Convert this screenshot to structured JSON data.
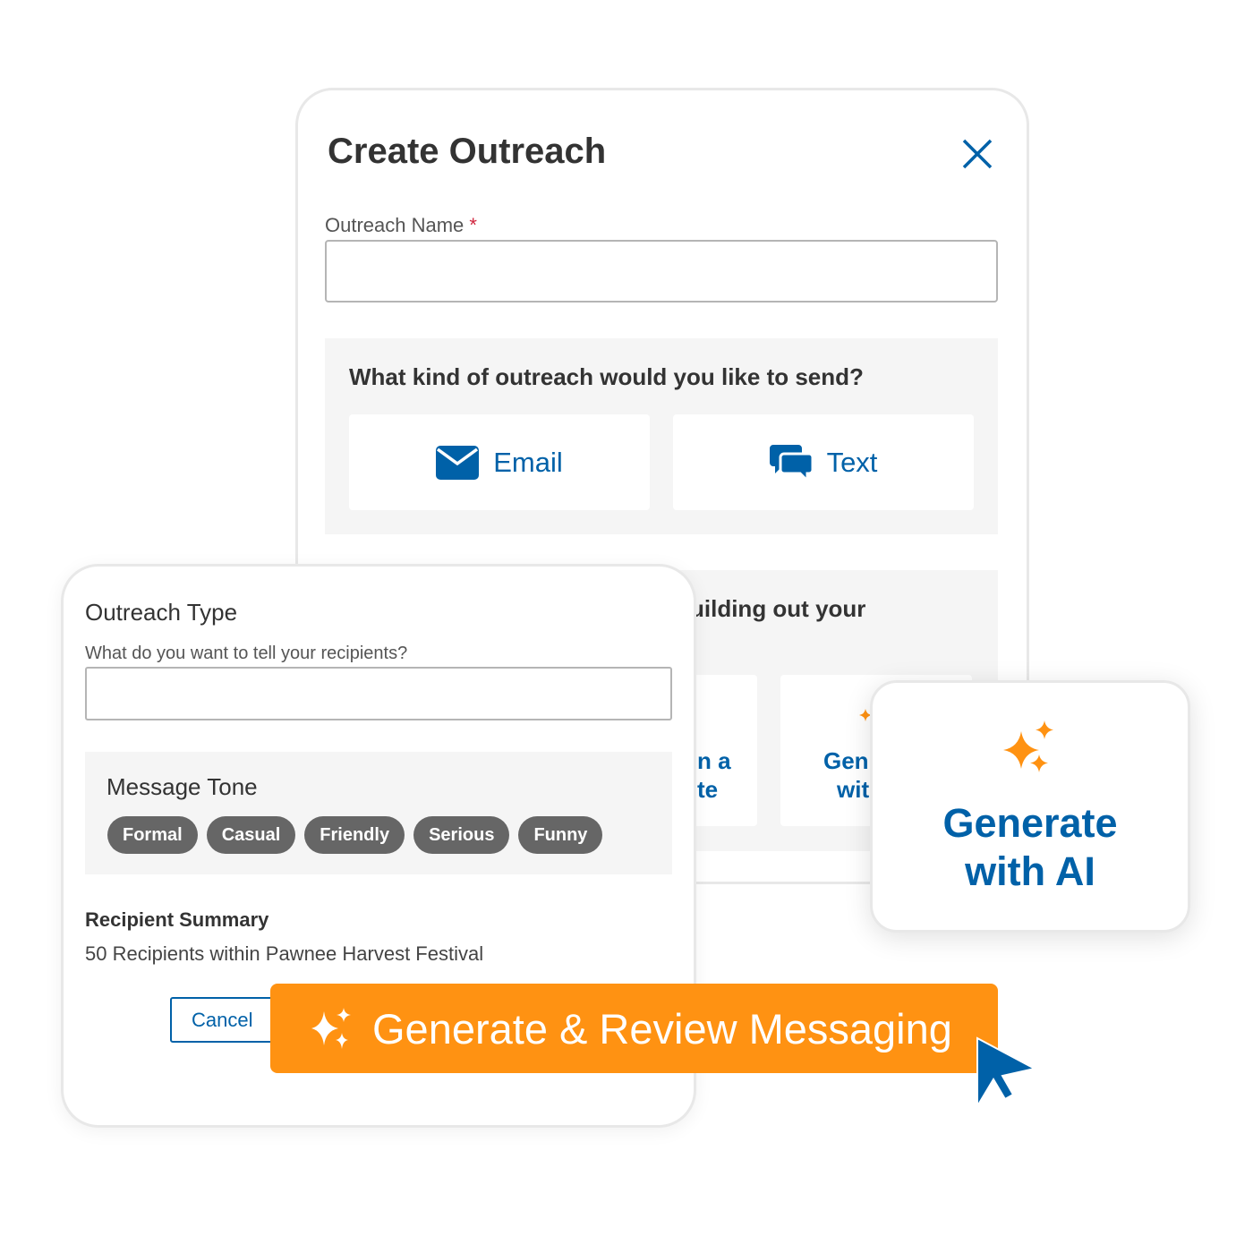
{
  "dialog": {
    "title": "Create Outreach",
    "close_icon": "close-icon",
    "name_label": "Outreach Name",
    "required_mark": "*",
    "name_value": "",
    "kind_question": "What kind of outreach would you like to send?",
    "options": [
      {
        "label": "Email",
        "icon": "envelope-icon"
      },
      {
        "label": "Text",
        "icon": "chat-bubbles-icon"
      }
    ],
    "build_text_fragment": "uilding out your",
    "start_options": [
      {
        "line1": "n a",
        "line2": "te"
      },
      {
        "line1": "Gen",
        "line2": "wit"
      }
    ]
  },
  "outreach_type": {
    "title": "Outreach Type",
    "question": "What do you want to tell your recipients?",
    "value": "",
    "tone_title": "Message Tone",
    "tones": [
      "Formal",
      "Casual",
      "Friendly",
      "Serious",
      "Funny"
    ],
    "recipient_title": "Recipient Summary",
    "recipient_text": "50 Recipients within Pawnee Harvest Festival",
    "cancel_label": "Cancel",
    "generate_label": "Generate & Review Messaging"
  },
  "ai_card": {
    "line1": "Generate",
    "line2": "with AI",
    "icon": "sparkle-icon"
  },
  "colors": {
    "primary": "#0061a8",
    "accent": "#ff9212",
    "chip": "#666666",
    "required": "#d0253d"
  }
}
